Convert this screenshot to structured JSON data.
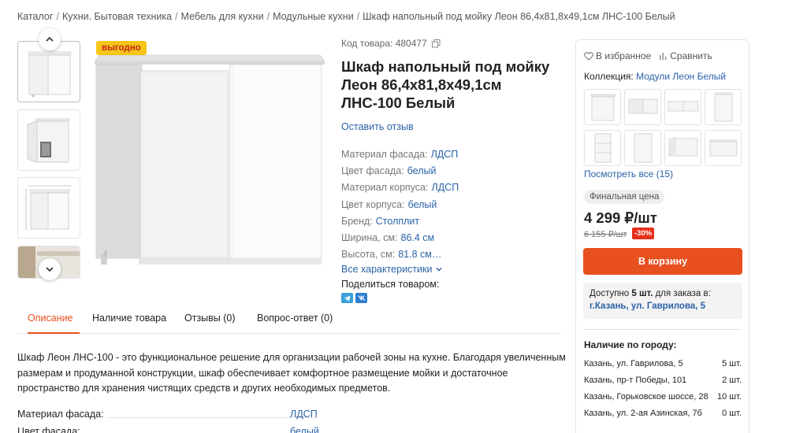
{
  "breadcrumb": [
    "Каталог",
    "Кухни. Бытовая техника",
    "Мебель для кухни",
    "Модульные кухни",
    "Шкаф напольный под мойку Леон 86,4x81,8x49,1см ЛНС-100 Белый"
  ],
  "gallery": {
    "badge": "выгодно"
  },
  "product": {
    "code_label": "Код товара: 480477",
    "title": "Шкаф напольный под мойку Леон 86,4x81,8x49,1см ЛНС-100 Белый",
    "review_link": "Оставить отзыв",
    "specs": [
      {
        "label": "Материал фасада:",
        "value": "ЛДСП"
      },
      {
        "label": "Цвет фасада:",
        "value": "белый"
      },
      {
        "label": "Материал корпуса:",
        "value": "ЛДСП"
      },
      {
        "label": "Цвет корпуса:",
        "value": "белый"
      },
      {
        "label": "Бренд:",
        "value": "Столплит"
      },
      {
        "label": "Ширина, см:",
        "value": "86.4 см"
      },
      {
        "label": "Высота, см:",
        "value": "81.8 см…"
      }
    ],
    "all_characteristics": "Все характеристики",
    "share_label": "Поделиться товаром:"
  },
  "tabs": [
    "Описание",
    "Наличие товара",
    "Отзывы (0)",
    "Вопрос-ответ (0)"
  ],
  "description": "Шкаф Леон ЛНС-100 - это функциональное решение для организации рабочей зоны на кухне. Благодаря увеличенным размерам и продуманной конструкции, шкаф обеспечивает комфортное размещение мойки и достаточное пространство для хранения чистящих средств и других необходимых предметов.",
  "attributes": [
    {
      "name": "Материал фасада:",
      "value": "ЛДСП"
    },
    {
      "name": "Цвет фасада:",
      "value": "белый"
    }
  ],
  "panel": {
    "favorite": "В избранное",
    "compare": "Сравнить",
    "collection_label": "Коллекция:",
    "collection_value": "Модули Леон Белый",
    "see_all": "Посмотреть все (15)",
    "final_price_label": "Финальная цена",
    "price": "4 299 ₽/шт",
    "old_price": "6 155 ₽/шт",
    "discount": "-30%",
    "cart_button": "В корзину",
    "stock_text_1": "Доступно",
    "stock_qty": "5 шт.",
    "stock_text_2": "для заказа в:",
    "stock_store": "г.Казань, ул. Гаврилова, 5",
    "city_title": "Наличие по городу:",
    "cities": [
      {
        "name": "Казань, ул. Гаврилова, 5",
        "qty": "5 шт."
      },
      {
        "name": "Казань, пр-т Победы, 101",
        "qty": "2 шт."
      },
      {
        "name": "Казань, Горьковское шоссе, 28",
        "qty": "10 шт."
      },
      {
        "name": "Казань, ул. 2-ая Азинская, 7б",
        "qty": "0 шт."
      }
    ]
  },
  "colors": {
    "accent": "#e8501f",
    "link": "#2a62a8",
    "badge_bg": "#f5c518",
    "discount_bg": "#e5311c"
  }
}
